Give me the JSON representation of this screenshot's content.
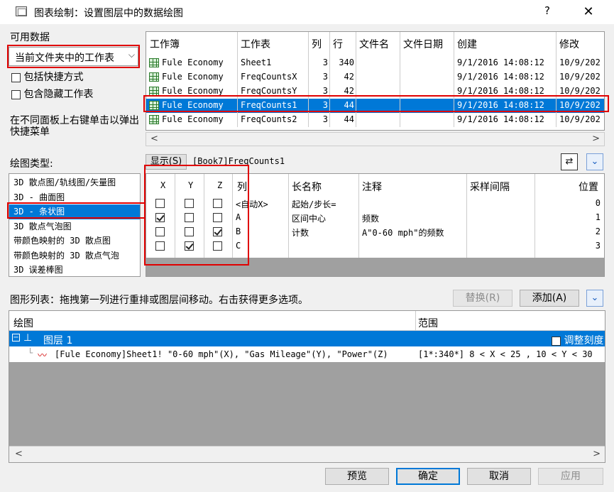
{
  "window": {
    "title": "图表绘制：设置图层中的数据绘图",
    "help_label": "?",
    "close_label": "✕"
  },
  "available_data": {
    "label": "可用数据",
    "dropdown_value": "当前文件夹中的工作表",
    "include_shortcuts": "包括快捷方式",
    "include_hidden": "包含隐藏工作表",
    "hint": "在不同面板上右键单击以弹出快捷菜单"
  },
  "book_table": {
    "headers": [
      "工作簿",
      "工作表",
      "列",
      "行",
      "文件名",
      "文件日期",
      "创建",
      "修改"
    ],
    "rows": [
      {
        "book": "Fule Economy",
        "sheet": "Sheet1",
        "cols": "3",
        "rows": "340",
        "file": "",
        "filedate": "",
        "created": "9/1/2016 14:08:12",
        "modified": "10/9/202"
      },
      {
        "book": "Fule Economy",
        "sheet": "FreqCountsX",
        "cols": "3",
        "rows": "42",
        "file": "",
        "filedate": "",
        "created": "9/1/2016 14:08:12",
        "modified": "10/9/202"
      },
      {
        "book": "Fule Economy",
        "sheet": "FreqCountsY",
        "cols": "3",
        "rows": "42",
        "file": "",
        "filedate": "",
        "created": "9/1/2016 14:08:12",
        "modified": "10/9/202"
      },
      {
        "book": "Fule Economy",
        "sheet": "FreqCounts1",
        "cols": "3",
        "rows": "44",
        "file": "",
        "filedate": "",
        "created": "9/1/2016 14:08:12",
        "modified": "10/9/202"
      },
      {
        "book": "Fule Economy",
        "sheet": "FreqCounts2",
        "cols": "3",
        "rows": "44",
        "file": "",
        "filedate": "",
        "created": "9/1/2016 14:08:12",
        "modified": "10/9/202"
      }
    ],
    "selected_index": 3
  },
  "plot_type": {
    "label": "绘图类型:",
    "items": [
      "3D 散点图/轨线图/矢量图",
      "3D - 曲面图",
      "3D - 条状图",
      "3D 散点气泡图",
      "带颜色映射的 3D 散点图",
      "带颜色映射的 3D 散点气泡",
      "3D 误差棒图"
    ],
    "selected_index": 2
  },
  "show_bar": {
    "button_label": "显示(S)",
    "path": "[Book7]FreqCounts1",
    "swap_icon": "swap-arrows-icon",
    "expand_icon": "double-chevron-down-icon"
  },
  "col_table": {
    "headers": [
      "X",
      "Y",
      "Z",
      "列",
      "长名称",
      "注释",
      "采样间隔",
      "位置"
    ],
    "rows": [
      {
        "x": false,
        "y": false,
        "z": false,
        "col": "<自动X>",
        "long": "起始/步长=",
        "comment": "",
        "pos": "0"
      },
      {
        "x": true,
        "y": false,
        "z": false,
        "col": "A",
        "long": "区间中心",
        "comment": "频数",
        "pos": "1"
      },
      {
        "x": false,
        "y": false,
        "z": true,
        "col": "B",
        "long": "计数",
        "comment": "A\"0-60 mph\"的频数",
        "pos": "2"
      },
      {
        "x": false,
        "y": true,
        "z": false,
        "col": "C",
        "long": "",
        "comment": "",
        "pos": "3"
      }
    ]
  },
  "plot_list": {
    "hint": "图形列表：拖拽第一列进行重排或图层间移动。右击获得更多选项。",
    "replace_label": "替换(R)",
    "add_label": "添加(A)",
    "col_plot": "绘图",
    "col_range": "范围",
    "layer_label": "图层 1",
    "rescale_label": "调整刻度",
    "plot_row_text": "[Fule Economy]Sheet1! \"0-60 mph\"(X), \"Gas Mileage\"(Y), \"Power\"(Z)",
    "plot_row_range": "[1*:340*]  8 < X < 25 , 10 < Y < 30"
  },
  "footer": {
    "preview": "预览",
    "ok": "确定",
    "cancel": "取消",
    "apply": "应用"
  },
  "colors": {
    "selection": "#0078d7",
    "highlight_box": "#e00000",
    "gray_area": "#a0a0a0"
  }
}
